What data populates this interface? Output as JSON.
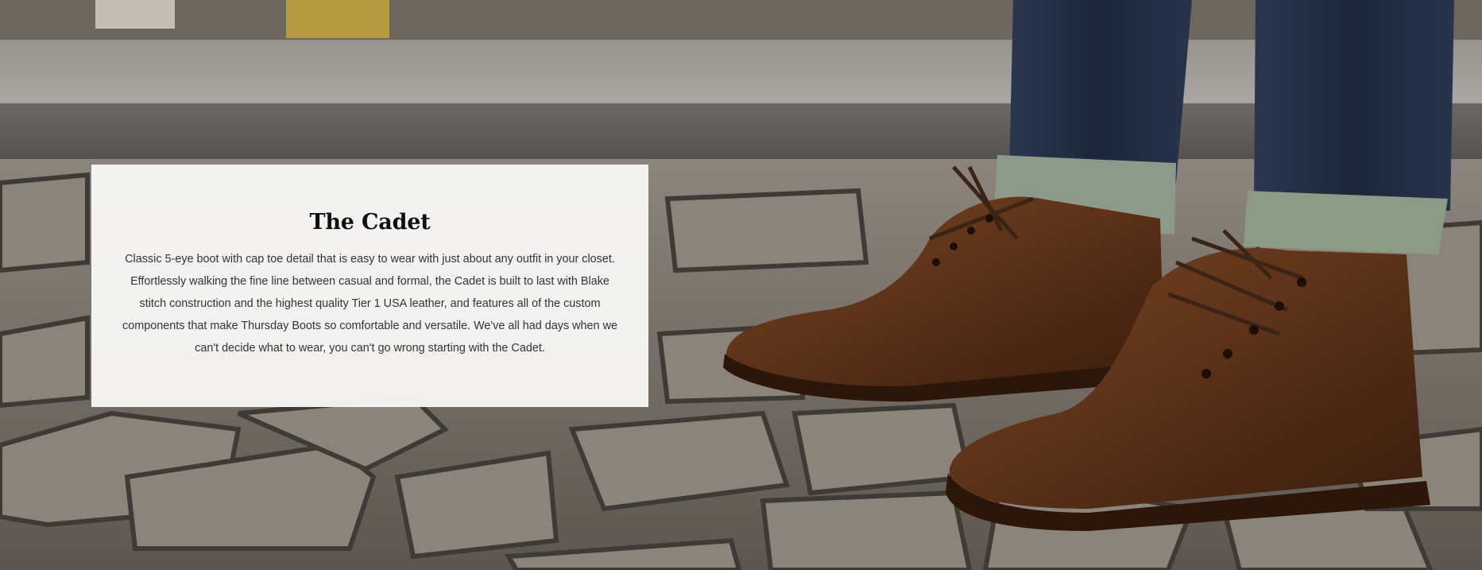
{
  "hero": {
    "image_alt": "Brown leather cap toe lace-up boots on cobblestone street",
    "colors": {
      "leather": "#5a3118",
      "denim": "#1b2638",
      "cobblestone": "#7c756c",
      "card": "#fafaf9"
    }
  },
  "product": {
    "title": "The Cadet",
    "description": "Classic 5-eye boot with cap toe detail that is easy to wear with just about any outfit in your closet. Effortlessly walking the fine line between casual and formal, the Cadet is built to last with Blake stitch construction and the highest quality Tier 1 USA leather, and features all of the custom components that make Thursday Boots so comfortable and versatile. We've all had days when we can't decide what to wear, you can't go wrong starting with the Cadet."
  }
}
